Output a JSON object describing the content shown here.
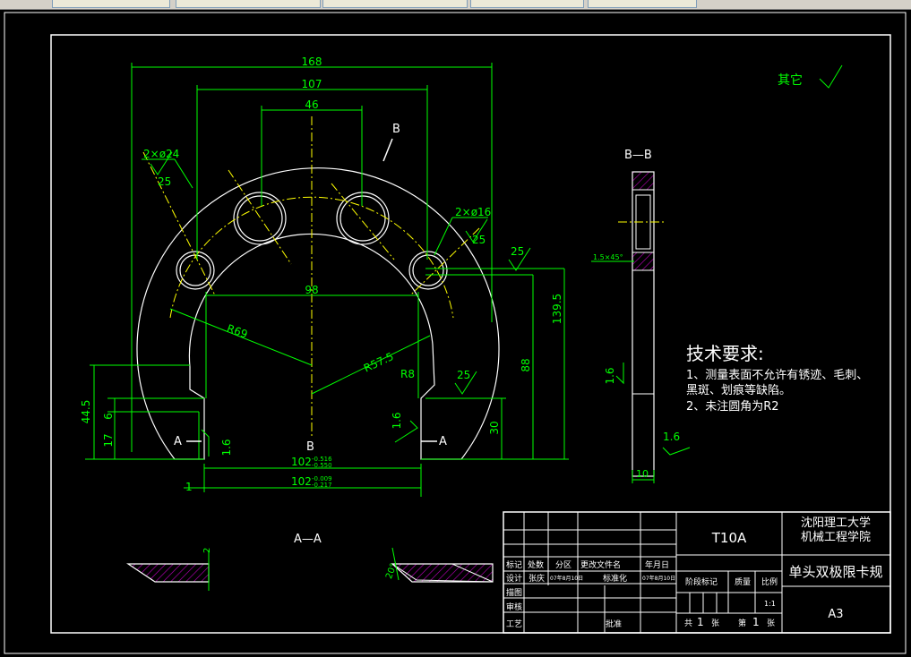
{
  "drawing": {
    "dims": {
      "d168": "168",
      "d107": "107",
      "d46": "46",
      "d98": "98",
      "d139_5": "139.5",
      "d88": "88",
      "d30": "30",
      "d44_5": "44.5",
      "d6": "6",
      "d17": "17",
      "d1": "1",
      "d2": "2",
      "d10": "10",
      "r69": "R69",
      "r57_5": "R57.5",
      "r8": "R8",
      "hole24_qty": "2×ø24",
      "hole16_qty": "2×ø16",
      "d102a": "102",
      "d102a_tol_up": "-0.516",
      "d102a_tol_lo": "-0.550",
      "d102b": "102",
      "d102b_tol_up": "-0.009",
      "d102b_tol_lo": "-0.217",
      "chamfer": "1.5×45°",
      "angle20": "20°"
    },
    "rough": {
      "r25a": "25",
      "r25b": "25",
      "r25c": "25",
      "r25d": "25",
      "r16a": "1.6",
      "r16b": "1.6",
      "r16c": "1.6",
      "r16d": "1.6"
    },
    "labels": {
      "b_top": "B",
      "b_bottom": "B",
      "a_left": "A",
      "a_right": "A",
      "section_bb": "B—B",
      "section_aa": "A—A",
      "other": "其它"
    },
    "tech": {
      "heading": "技术要求:",
      "line1": "1、测量表面不允许有锈迹、毛刺、",
      "line2": "黑斑、划痕等缺陷。",
      "line3": "2、未注圆角为R2"
    }
  },
  "title_block": {
    "material": "T10A",
    "school_line1": "沈阳理工大学",
    "school_line2": "机械工程学院",
    "part_name": "单头双极限卡规",
    "sheet_size": "A3",
    "h_mark": "标记",
    "h_count": "处数",
    "h_zone": "分区",
    "h_change_doc": "更改文件名",
    "h_date": "年月日",
    "r_design": "设计",
    "designer": "张庆",
    "design_date": "07年8月10日",
    "r_standard": "标准化",
    "standard_date": "07年8月10日",
    "h_stage": "阶段标记",
    "h_mass": "质量",
    "h_scale": "比例",
    "scale_value": "1:1",
    "r_draw": "描图",
    "r_check": "审核",
    "r_process": "工艺",
    "r_approve": "批准",
    "total_prefix": "共",
    "total_num": "1",
    "total_unit": "张",
    "sheet_prefix": "第",
    "sheet_num": "1",
    "sheet_unit": "张"
  }
}
